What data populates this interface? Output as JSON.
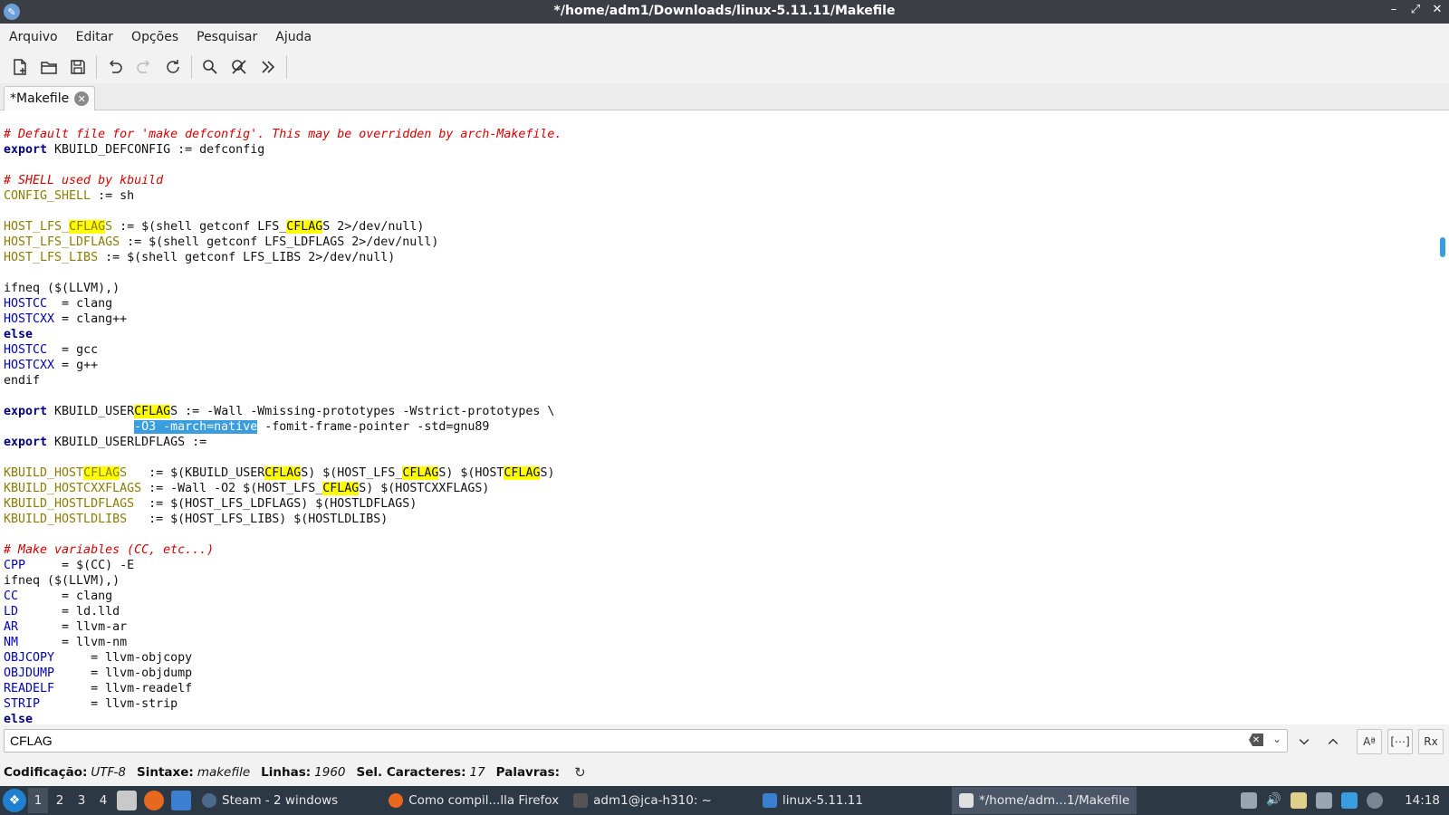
{
  "window": {
    "title": "*/home/adm1/Downloads/linux-5.11.11/Makefile",
    "min": "–",
    "max": "⤢",
    "close": "✕"
  },
  "menu": [
    "Arquivo",
    "Editar",
    "Opções",
    "Pesquisar",
    "Ajuda"
  ],
  "toolbar_icons": [
    "new-file-icon",
    "open-folder-icon",
    "save-icon",
    "undo-icon",
    "redo-icon",
    "reload-icon",
    "search-icon",
    "replace-icon",
    "more-icon"
  ],
  "tab": {
    "label": "*Makefile",
    "close": "✕"
  },
  "code": {
    "l1": "# Default file for 'make defconfig'. This may be overridden by arch-Makefile.",
    "l2a": "export",
    "l2b": " KBUILD_DEFCONFIG := defconfig",
    "l4": "# SHELL used by kbuild",
    "l5a": "CONFIG_SHELL",
    "l5b": " := sh",
    "l7a": "HOST_LFS_",
    "l7b": "CFLAG",
    "l7c": "S",
    "l7d": " := $(shell getconf LFS_",
    "l7e": "CFLAG",
    "l7f": "S 2>/dev/null)",
    "l8a": "HOST_LFS_LDFLAGS",
    "l8b": " := $(shell getconf LFS_LDFLAGS 2>/dev/null)",
    "l9a": "HOST_LFS_LIBS",
    "l9b": " := $(shell getconf LFS_LIBS 2>/dev/null)",
    "l11": "ifneq ($(LLVM),)",
    "l12a": "HOSTCC",
    "l12b": "  = clang",
    "l13a": "HOSTCXX",
    "l13b": " = clang++",
    "l14": "else",
    "l15a": "HOSTCC",
    "l15b": "  = gcc",
    "l16a": "HOSTCXX",
    "l16b": " = g++",
    "l17": "endif",
    "l19a": "export",
    "l19b": " KBUILD_USER",
    "l19c": "CFLAG",
    "l19d": "S := -Wall -Wmissing-prototypes -Wstrict-prototypes \\",
    "l20a": "                  ",
    "l20b": "-O3 -march=native",
    "l20c": " -fomit-frame-pointer -std=gnu89",
    "l21a": "export",
    "l21b": " KBUILD_USERLDFLAGS :=",
    "l23a": "KBUILD_HOST",
    "l23b": "CFLAG",
    "l23c": "S",
    "l23d": "   := $(KBUILD_USER",
    "l23e": "CFLAG",
    "l23f": "S) $(HOST_LFS_",
    "l23g": "CFLAG",
    "l23h": "S) $(HOST",
    "l23i": "CFLAG",
    "l23j": "S)",
    "l24a": "KBUILD_HOSTCXXFLAGS",
    "l24b": " := -Wall -O2 $(HOST_LFS_",
    "l24c": "CFLAG",
    "l24d": "S) $(HOSTCXXFLAGS)",
    "l25a": "KBUILD_HOSTLDFLAGS",
    "l25b": "  := $(HOST_LFS_LDFLAGS) $(HOSTLDFLAGS)",
    "l26a": "KBUILD_HOSTLDLIBS",
    "l26b": "   := $(HOST_LFS_LIBS) $(HOSTLDLIBS)",
    "l28": "# Make variables (CC, etc...)",
    "l29a": "CPP",
    "l29b": "     = $(CC) -E",
    "l30": "ifneq ($(LLVM),)",
    "l31a": "CC",
    "l31b": "      = clang",
    "l32a": "LD",
    "l32b": "      = ld.lld",
    "l33a": "AR",
    "l33b": "      = llvm-ar",
    "l34a": "NM",
    "l34b": "      = llvm-nm",
    "l35a": "OBJCOPY",
    "l35b": "     = llvm-objcopy",
    "l36a": "OBJDUMP",
    "l36b": "     = llvm-objdump",
    "l37a": "READELF",
    "l37b": "     = llvm-readelf",
    "l38a": "STRIP",
    "l38b": "       = llvm-strip",
    "l39": "else"
  },
  "search": {
    "value": "CFLAG",
    "placeholder": ""
  },
  "status": {
    "enc_label": "Codificação:",
    "enc_value": "UTF-8",
    "syn_label": "Sintaxe:",
    "syn_value": "makefile",
    "lines_label": "Linhas:",
    "lines_value": "1960",
    "sel_label": "Sel. Caracteres:",
    "sel_value": "17",
    "words_label": "Palavras:"
  },
  "taskbar": {
    "workspaces": [
      "1",
      "2",
      "3",
      "4"
    ],
    "tasks": [
      "Steam - 2 windows",
      "Como compil...lla Firefox",
      "adm1@jca-h310: ~",
      "linux-5.11.11",
      "*/home/adm...1/Makefile"
    ],
    "clock": "14:18"
  },
  "colors": {
    "accent": "#3a9de0",
    "highlight": "#ffff00",
    "comment": "#d90000",
    "keyword": "#000080"
  }
}
